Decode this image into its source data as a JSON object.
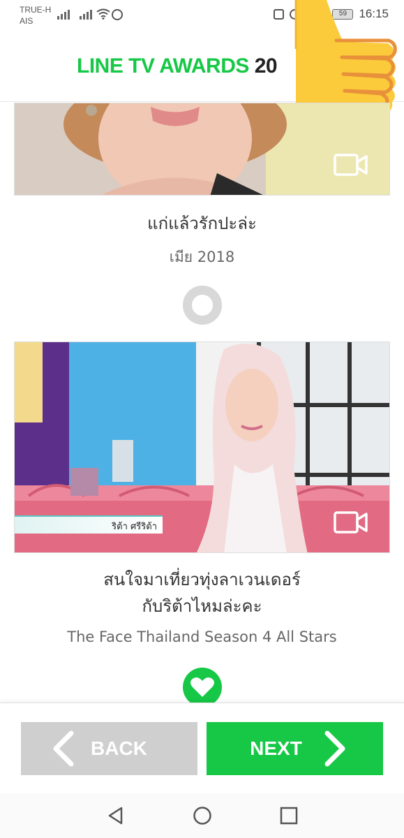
{
  "status_bar": {
    "carrier_line1": "TRUE-H",
    "carrier_line2": "AIS",
    "battery": "59",
    "time": "16:15"
  },
  "header": {
    "logo_main": "LINE TV AWARDS ",
    "logo_year": "20"
  },
  "cards": [
    {
      "title": "แก่แล้วรักปะล่ะ",
      "subtitle": "เมีย 2018",
      "icon": "video-camera-icon",
      "vote_state": "unselected-ring"
    },
    {
      "title_line1": "สนใจมาเที่ยวทุ่งลาเวนเดอร์",
      "title_line2": "กับริต้าไหมล่ะคะ",
      "subtitle": "The Face Thailand Season 4 All Stars",
      "caption": "ริต้า ศรีริต้า",
      "icon": "video-camera-icon",
      "vote_state": "selected-heart"
    }
  ],
  "nav": {
    "back_label": "BACK",
    "next_label": "NEXT"
  },
  "colors": {
    "brand_green": "#16c846",
    "back_gray": "#cfcfcf"
  }
}
